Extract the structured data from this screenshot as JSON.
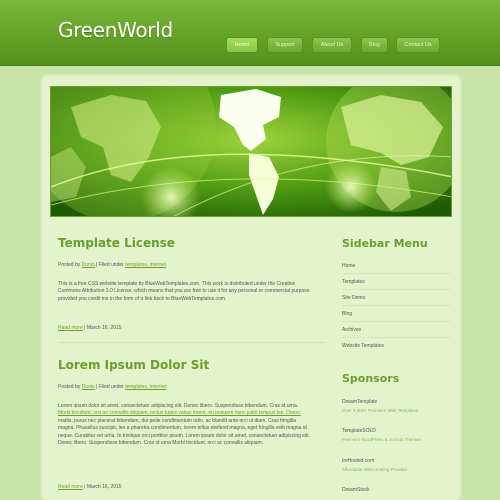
{
  "header": {
    "logo": "GreenWorld",
    "nav": [
      {
        "label": "Home",
        "active": true
      },
      {
        "label": "Support",
        "active": false
      },
      {
        "label": "About Us",
        "active": false
      },
      {
        "label": "Blog",
        "active": false
      },
      {
        "label": "Contact Us",
        "active": false
      }
    ]
  },
  "posts": [
    {
      "title": "Template License",
      "posted_by_label": "Posted by",
      "author": "Dunio",
      "filed_label": "| Filed under",
      "category": "templates, internet",
      "paragraph_lines": [
        "This is a free CSS website template by BlueWebTemplates.com. This work is distributed under the Creative",
        "Commons Attribution 3.0 License, which means that you are free to use it for any personal or commercial purpose",
        "provided you credit me in the form of a link back to BlueWebTemplates.com."
      ],
      "read_more": "Read more",
      "date": "| March 16, 2015"
    },
    {
      "title": "Lorem Ipsum Dolor Sit",
      "posted_by_label": "Posted by",
      "author": "Dunio",
      "filed_label": "| Filed under",
      "category": "templates, internet",
      "paragraph_lines": [
        "Lorem ipsum dolor sit amet, consectetuer adipiscing elit. Donec libero. Suspendisse bibendum. Cras id urna.",
        "Morbi tincidunt, orci ac convallis aliquam, lectus turpis varius lorem, eu posuere nunc justo tempus leo. Donec",
        "mattis, purus nec placerat bibendum, dui pede condimentum odio, ac blandit ante orci ut diam. Cras fringilla",
        "magna. Phasellus suscipit, leo a pharetra condimentum, lorem tellus eleifend magna, eget fringilla velit magna id",
        "neque. Curabitur vel urna. In tristique orci porttitor ipsum. Lorem ipsum dolor sit amet, consectetuer adipiscing elit.",
        "Donec libero. Suspendisse bibendum. Cras id urna Morbi tincidunt, orci ac convallis aliquam."
      ],
      "read_more": "Read more",
      "date": "| March 16, 2015"
    }
  ],
  "sidebar": {
    "menu_title": "Sidebar Menu",
    "menu_items": [
      "Home",
      "Templates",
      "Site Demo",
      "Blog",
      "Archives",
      "Website Templates"
    ],
    "sponsors_title": "Sponsors",
    "sponsors": [
      {
        "name": "DreamTemplate",
        "desc": "Over 6,000+ Premium Web Templates"
      },
      {
        "name": "TemplateSOLD",
        "desc": "Premium WordPress & Joomla Themes"
      },
      {
        "name": "ImHosted.com",
        "desc": "Affordable Web Hosting Provider"
      },
      {
        "name": "DreamStock",
        "desc": ""
      }
    ]
  },
  "colors": {
    "header_green": "#5e9d22",
    "accent_green": "#6b9d2f",
    "page_bg": "#e4f3cc",
    "outer_bg": "#c9e4a8"
  }
}
